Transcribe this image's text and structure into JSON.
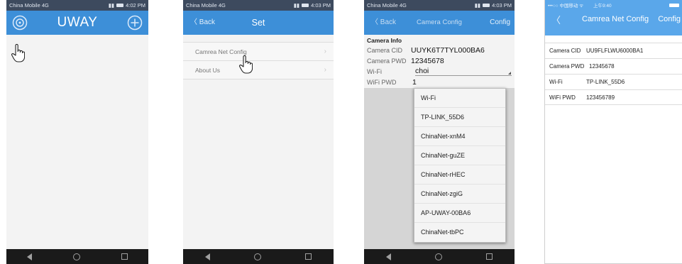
{
  "screen1": {
    "status_left": "China Mobile 4G",
    "status_time": "4:02 PM",
    "title": "UWAY",
    "settings_icon": "camera-ring-icon",
    "add_icon": "plus-circle-icon"
  },
  "screen2": {
    "status_left": "China Mobile 4G",
    "status_time": "4:03 PM",
    "back_label": "〈 Back",
    "title": "Set",
    "items": [
      {
        "label": "Camrea Net Config"
      },
      {
        "label": "About Us"
      }
    ]
  },
  "screen3": {
    "status_left": "China Mobile 4G",
    "status_time": "4:03 PM",
    "back_label": "〈 Back",
    "title": "Camera Config",
    "config_label": "Config",
    "section_label": "Camera Info",
    "cid_label": "Camera CID",
    "cid_value": "UUYK6T7TYL000BA6",
    "pwd_label": "Camera PWD",
    "pwd_value": "12345678",
    "wifi_label": "Wi-Fi",
    "wifi_value": "choi",
    "wifipwd_label": "WiFi PWD",
    "wifipwd_value": "1",
    "dropdown": [
      "Wi-Fi",
      "TP-LINK_55D6",
      "ChinaNet-xnM4",
      "ChinaNet-guZE",
      "ChinaNet-rHEC",
      "ChinaNet-zgiG",
      "AP-UWAY-00BA6",
      "ChinaNet-tbPC"
    ]
  },
  "screen4": {
    "status_left": "•••○○ 中国移动 ᯤ",
    "status_time": "上午9:40",
    "back_label": "〈",
    "title": "Camrea Net Config",
    "config_label": "Config",
    "rows": [
      {
        "label": "Camera CID",
        "value": "UU9FLFLWU6000BA1"
      },
      {
        "label": "Camera PWD",
        "value": "12345678"
      },
      {
        "label": "Wi-Fi",
        "value": "TP-LINK_55D6"
      },
      {
        "label": "WiFi PWD",
        "value": "123456789"
      }
    ]
  },
  "colors": {
    "appbar": "#3d8fd8",
    "status": "#3d4a5e",
    "ios_bar": "#5aa7ea"
  }
}
